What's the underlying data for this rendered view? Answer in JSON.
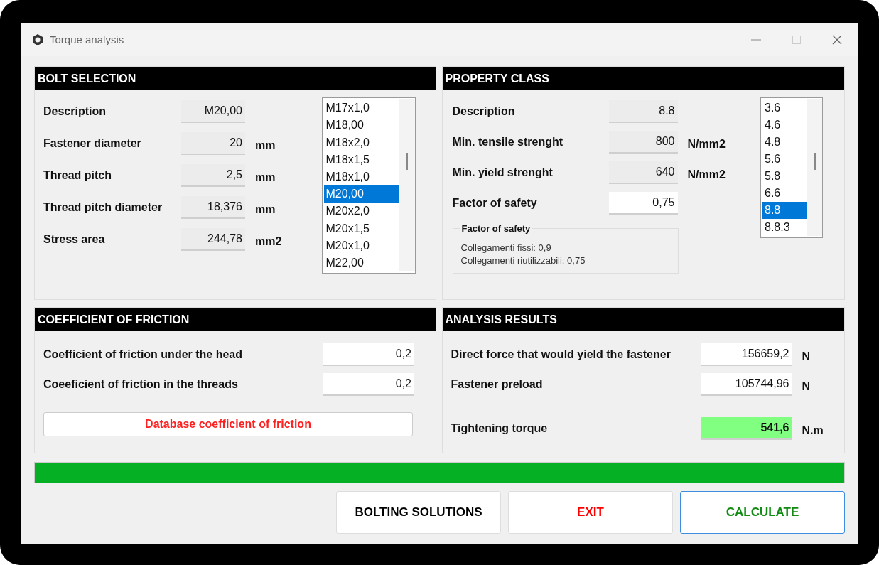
{
  "window": {
    "title": "Torque analysis"
  },
  "bolt_selection": {
    "title": "BOLT SELECTION",
    "fields": [
      {
        "label": "Description",
        "value": "M20,00",
        "editable": false
      },
      {
        "label": "Fastener diameter",
        "value": "20",
        "unit": "mm",
        "editable": false
      },
      {
        "label": "Thread pitch",
        "value": "2,5",
        "unit": "mm",
        "editable": false
      },
      {
        "label": "Thread pitch diameter",
        "value": "18,376",
        "unit": "mm",
        "editable": false
      },
      {
        "label": "Stress area",
        "value": "244,78",
        "unit": "mm2",
        "editable": false
      }
    ],
    "list": [
      {
        "label": "M17x1,0",
        "selected": false
      },
      {
        "label": "M18,00",
        "selected": false
      },
      {
        "label": "M18x2,0",
        "selected": false
      },
      {
        "label": "M18x1,5",
        "selected": false
      },
      {
        "label": "M18x1,0",
        "selected": false
      },
      {
        "label": "M20,00",
        "selected": true
      },
      {
        "label": "M20x2,0",
        "selected": false
      },
      {
        "label": "M20x1,5",
        "selected": false
      },
      {
        "label": "M20x1,0",
        "selected": false
      },
      {
        "label": "M22,00",
        "selected": false
      }
    ]
  },
  "property_class": {
    "title": "PROPERTY CLASS",
    "fields": [
      {
        "label": "Description",
        "value": "8.8",
        "editable": false
      },
      {
        "label": "Min. tensile strenght",
        "value": "800",
        "unit": "N/mm2",
        "editable": false
      },
      {
        "label": "Min. yield strenght",
        "value": "640",
        "unit": "N/mm2",
        "editable": false
      },
      {
        "label": "Factor of safety",
        "value": "0,75",
        "editable": true
      }
    ],
    "note": {
      "title": "Factor of safety",
      "lines": [
        "Collegamenti fissi: 0,9",
        "Collegamenti riutilizzabili: 0,75"
      ]
    },
    "list": [
      {
        "label": "3.6",
        "selected": false
      },
      {
        "label": "4.6",
        "selected": false
      },
      {
        "label": "4.8",
        "selected": false
      },
      {
        "label": "5.6",
        "selected": false
      },
      {
        "label": "5.8",
        "selected": false
      },
      {
        "label": "6.6",
        "selected": false
      },
      {
        "label": "8.8",
        "selected": true
      },
      {
        "label": "8.8.3",
        "selected": false
      }
    ]
  },
  "coefficient_of_friction": {
    "title": "COEFFICIENT OF FRICTION",
    "fields": [
      {
        "label": "Coefficient of friction under the head",
        "value": "0,2",
        "editable": true
      },
      {
        "label": "Coeeficient of friction in the threads",
        "value": "0,2",
        "editable": true
      }
    ],
    "button": "Database coefficient of friction"
  },
  "analysis_results": {
    "title": "ANALYSIS RESULTS",
    "fields": [
      {
        "label": "Direct force that would yield the fastener",
        "value": "156659,2",
        "unit": "N",
        "highlighted": false
      },
      {
        "label": "Fastener preload",
        "value": "105744,96",
        "unit": "N",
        "highlighted": false
      },
      {
        "label": "Tightening torque",
        "value": "541,6",
        "unit": "N.m",
        "highlighted": true
      }
    ]
  },
  "progress": {
    "level": 1
  },
  "buttons": [
    {
      "label": "BOLTING SOLUTIONS",
      "kind": "neutral"
    },
    {
      "label": "EXIT",
      "kind": "danger"
    },
    {
      "label": "CALCULATE",
      "kind": "primary"
    }
  ]
}
